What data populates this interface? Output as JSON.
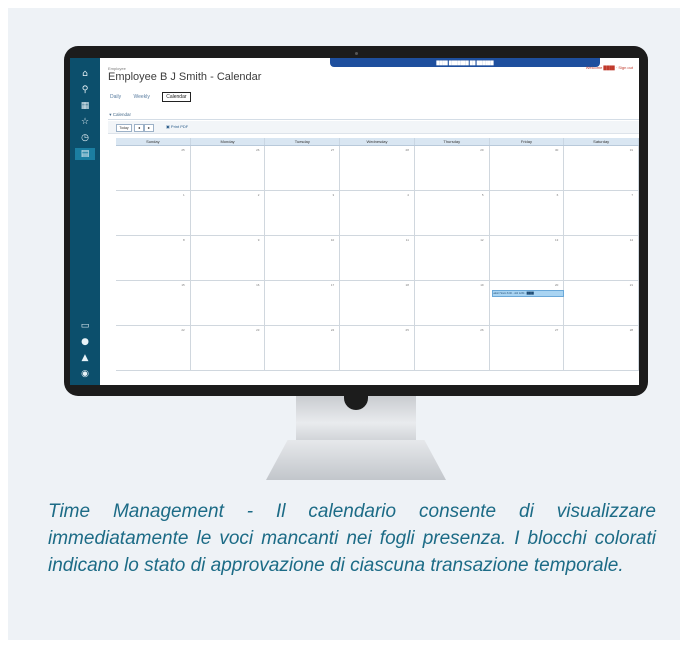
{
  "app": {
    "breadcrumb": "Employee",
    "page_title": "Employee B J Smith - Calendar",
    "top_strip": "████ ███████ ██ ██████",
    "signout": "Welcome ████ · Sign out",
    "view_tabs": {
      "daily": "Daily",
      "weekly": "Weekly",
      "calendar": "Calendar"
    },
    "panel_title": "Calendar",
    "toolbar": {
      "today": "Today",
      "prev": "◄",
      "next": "►",
      "print": "Print PDF"
    },
    "days": [
      "Sunday",
      "Monday",
      "Tuesday",
      "Wednesday",
      "Thursday",
      "Friday",
      "Saturday"
    ],
    "weeks": [
      [
        "25",
        "26",
        "27",
        "28",
        "29",
        "30",
        "31"
      ],
      [
        "1",
        "2",
        "3",
        "4",
        "5",
        "6",
        "7"
      ],
      [
        "8",
        "9",
        "10",
        "11",
        "12",
        "13",
        "14"
      ],
      [
        "15",
        "16",
        "17",
        "18",
        "19",
        "20",
        "21"
      ],
      [
        "22",
        "23",
        "24",
        "25",
        "26",
        "27",
        "28"
      ]
    ],
    "event": {
      "label": "Labor Hours 8.00 - Job 1234 ·  ████",
      "color": "#a9d4f2"
    },
    "sidebar_icons": [
      "home-icon",
      "search-icon",
      "grid-icon",
      "star-icon",
      "clock-icon",
      "report-icon"
    ],
    "sidebar_bottom_icons": [
      "chat-icon",
      "help-icon",
      "bell-icon",
      "user-icon"
    ],
    "sidebar_color": "#0c4f6c"
  },
  "caption": "Time Management - Il calendario consente di visualizzare immediatamente le voci mancanti nei fogli presenza. I blocchi colorati indicano lo stato di approvazione di ciascuna transazione temporale."
}
